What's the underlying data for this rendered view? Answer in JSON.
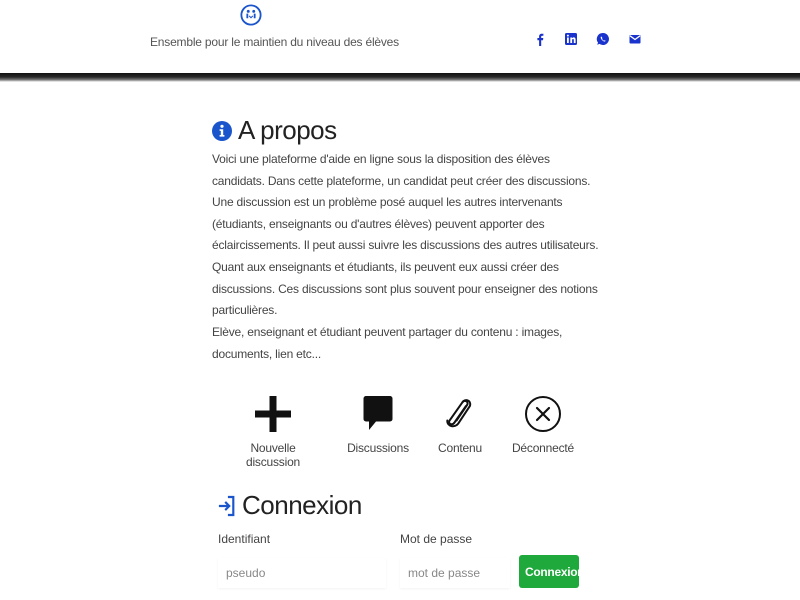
{
  "header": {
    "logo_icon": "people-exchange-icon",
    "tagline": "Ensemble pour le maintien du niveau des élèves",
    "social": [
      {
        "name": "facebook-icon",
        "color": "#1a33cc"
      },
      {
        "name": "linkedin-icon",
        "color": "#1a33cc"
      },
      {
        "name": "whatsapp-icon",
        "color": "#1a33cc"
      },
      {
        "name": "mail-icon",
        "color": "#1a33cc"
      }
    ]
  },
  "about": {
    "title": "A propos",
    "paragraphs": [
      "Voici une plateforme d'aide en ligne sous la disposition des élèves candidats. Dans cette plateforme, un candidat peut créer des discussions. Une discussion est un problème posé auquel les autres intervenants (étudiants, enseignants ou d'autres élèves) peuvent apporter des éclaircissements. Il peut aussi suivre les discussions des autres utilisateurs.",
      "Quant aux enseignants et étudiants, ils peuvent eux aussi créer des discussions. Ces discussions sont plus souvent pour enseigner des notions particulières.",
      "Elève, enseignant et étudiant peuvent partager du contenu : images, documents, lien etc..."
    ]
  },
  "actions": [
    {
      "label": "Nouvelle discussion",
      "icon": "plus-icon"
    },
    {
      "label": "Discussions",
      "icon": "speech-bubble-icon"
    },
    {
      "label": "Contenu",
      "icon": "paperclip-icon"
    },
    {
      "label": "Déconnecté",
      "icon": "circle-x-icon"
    }
  ],
  "login": {
    "title": "Connexion",
    "username_label": "Identifiant",
    "username_placeholder": "pseudo",
    "password_label": "Mot de passe",
    "password_placeholder": "mot de passe",
    "submit_label": "Connexion"
  },
  "colors": {
    "accent_blue": "#1a33cc",
    "button_green": "#1fa83b"
  }
}
